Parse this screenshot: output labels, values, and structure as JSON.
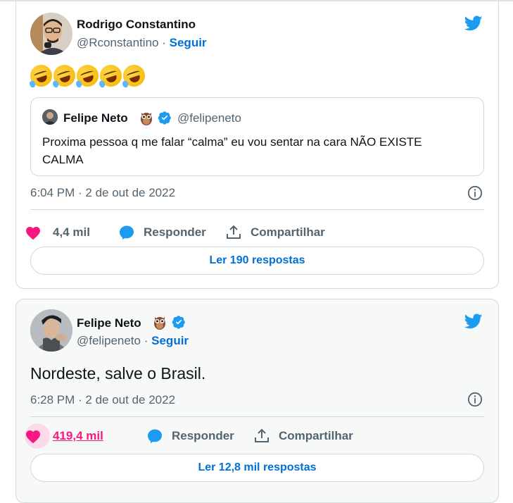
{
  "tweets": [
    {
      "author": {
        "name": "Rodrigo Constantino",
        "handle": "@Rconstantino",
        "separator": "·",
        "follow_label": "Seguir"
      },
      "emoji_count": 5,
      "quoted": {
        "name": "Felipe Neto",
        "handle": "@felipeneto",
        "text": "Proxima pessoa q me falar “calma” eu vou sentar na cara NÃO EXISTE CALMA"
      },
      "timestamp": "6:04 PM · 2 de out de 2022",
      "likes": "4,4 mil",
      "reply_label": "Responder",
      "share_label": "Compartilhar",
      "read_replies": "Ler 190 respostas"
    },
    {
      "author": {
        "name": "Felipe Neto",
        "handle": "@felipeneto",
        "separator": "·",
        "follow_label": "Seguir"
      },
      "text": "Nordeste, salve o Brasil.",
      "timestamp": "6:28 PM · 2 de out de 2022",
      "likes": "419,4 mil",
      "reply_label": "Responder",
      "share_label": "Compartilhar",
      "read_replies": "Ler 12,8 mil respostas"
    }
  ],
  "colors": {
    "brand_blue": "#1d9bf0",
    "like_pink": "#f91880",
    "link_blue": "#006fd6"
  },
  "icons": [
    "twitter-bird-icon",
    "heart-icon",
    "reply-bubble-icon",
    "share-icon",
    "info-icon",
    "verified-badge-icon",
    "owl-emoji-icon",
    "rofl-emoji-icon"
  ]
}
